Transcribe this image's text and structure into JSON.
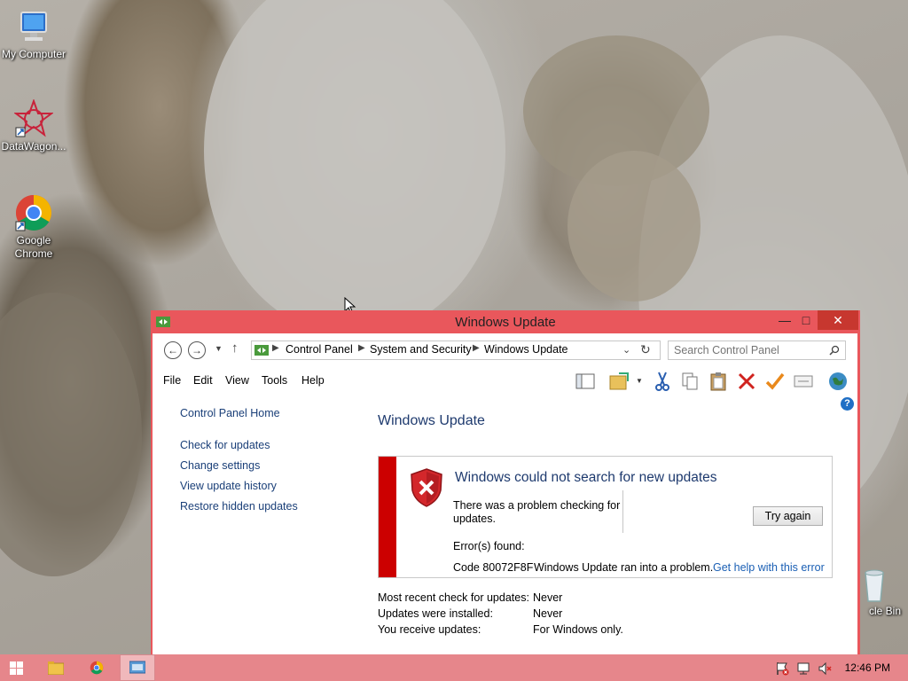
{
  "desktop": {
    "icons": [
      {
        "label": "My Computer"
      },
      {
        "label": "DataWagon..."
      },
      {
        "label": "Google Chrome"
      },
      {
        "label": "cle Bin"
      }
    ]
  },
  "window": {
    "title": "Windows Update",
    "close_glyph": "✕",
    "min_glyph": "—",
    "max_glyph": "□"
  },
  "address": {
    "crumbs": [
      "Control Panel",
      "System and Security",
      "Windows Update"
    ],
    "search_placeholder": "Search Control Panel"
  },
  "menu": {
    "items": [
      "File",
      "Edit",
      "View",
      "Tools",
      "Help"
    ]
  },
  "left_pane": {
    "home": "Control Panel Home",
    "links": [
      "Check for updates",
      "Change settings",
      "View update history",
      "Restore hidden updates"
    ]
  },
  "main": {
    "heading": "Windows Update",
    "error": {
      "title": "Windows could not search for new updates",
      "message_line1": "There was a problem checking for",
      "message_line2": "updates.",
      "errors_found": "Error(s) found:",
      "code": "Code 80072F8F",
      "description": "Windows Update ran into a problem.",
      "help_link": "Get help with this error",
      "try_again": "Try again"
    },
    "info": [
      {
        "label": "Most recent check for updates:",
        "value": "Never"
      },
      {
        "label": "Updates were installed:",
        "value": "Never"
      },
      {
        "label": "You receive updates:",
        "value": "For Windows only."
      }
    ]
  },
  "taskbar": {
    "clock": "12:46 PM"
  },
  "colors": {
    "window_frame": "#e9575c",
    "taskbar": "#e6868b",
    "error_stripe": "#cc0000",
    "link": "#1a3f78"
  }
}
